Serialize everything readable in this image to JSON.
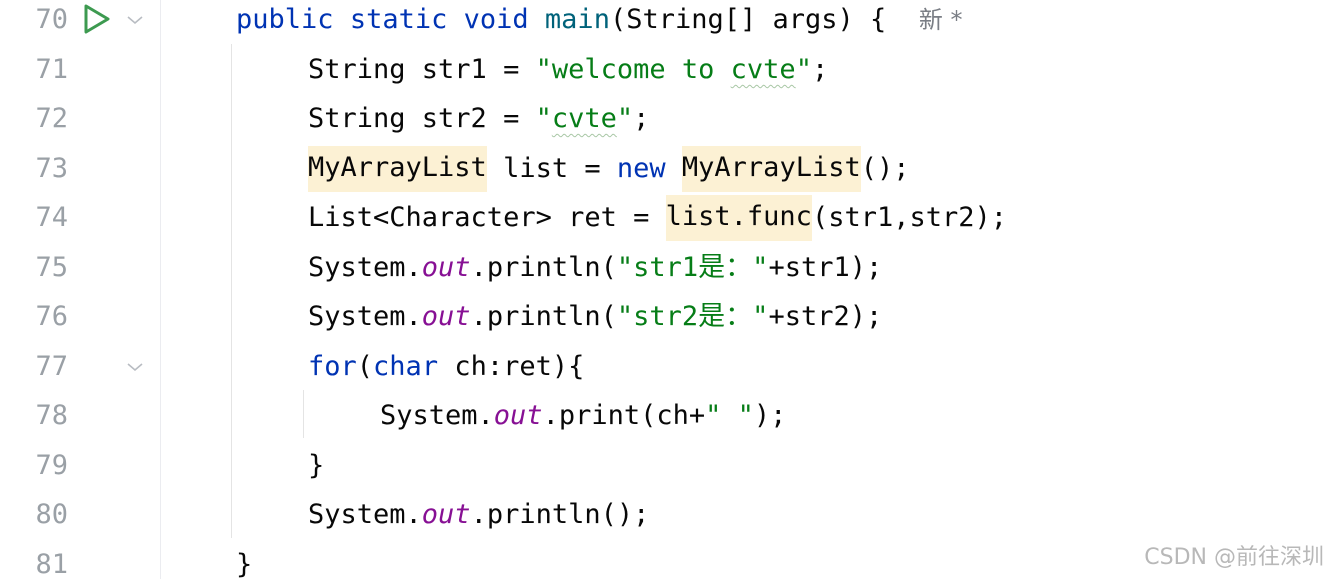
{
  "gutter": {
    "line_numbers": [
      "70",
      "71",
      "72",
      "73",
      "74",
      "75",
      "76",
      "77",
      "78",
      "79",
      "80",
      "81"
    ],
    "run_icon": "run-gutter-icon",
    "fold_icon": "chevron-down-icon",
    "colors": {
      "run": "#3d9a50",
      "line_number": "#9aa0a6"
    }
  },
  "code": {
    "line70": {
      "t1": "public",
      "t2": "static",
      "t3": "void",
      "t4": "main",
      "t5": "(String[] args) {",
      "hint": "新 *"
    },
    "line71": {
      "t1": "String str1 = ",
      "t2": "\"",
      "t3": "welcome to ",
      "t4": "cvte",
      "t5": "\"",
      "t6": ";"
    },
    "line72": {
      "t1": "String str2 = ",
      "t2": "\"",
      "t3": "cvte",
      "t4": "\"",
      "t5": ";"
    },
    "line73": {
      "t1": "MyArrayList",
      "t2": " list = ",
      "t3": "new",
      "t4": "MyArrayList",
      "t5": "();"
    },
    "line74": {
      "t1": "List<Character> ret = ",
      "t2": "list.func",
      "t3": "(str1,str2);"
    },
    "line75": {
      "t1": "System.",
      "t2": "out",
      "t3": ".println(",
      "t4": "\"str1是：\"",
      "t5": "+str1);"
    },
    "line76": {
      "t1": "System.",
      "t2": "out",
      "t3": ".println(",
      "t4": "\"str2是：\"",
      "t5": "+str2);"
    },
    "line77": {
      "t1": "for",
      "t2": "(",
      "t3": "char",
      "t4": " ch:ret){"
    },
    "line78": {
      "t1": "System.",
      "t2": "out",
      "t3": ".print(ch+",
      "t4": "\" \"",
      "t5": ");"
    },
    "line79": {
      "t1": "}"
    },
    "line80": {
      "t1": "System.",
      "t2": "out",
      "t3": ".println();"
    },
    "line81": {
      "t1": "}"
    }
  },
  "watermark": "CSDN @前往深圳",
  "colors": {
    "keyword": "#0033b3",
    "string": "#067d17",
    "method": "#00627a",
    "static_field": "#871094",
    "highlight": "#fcf1d4"
  }
}
